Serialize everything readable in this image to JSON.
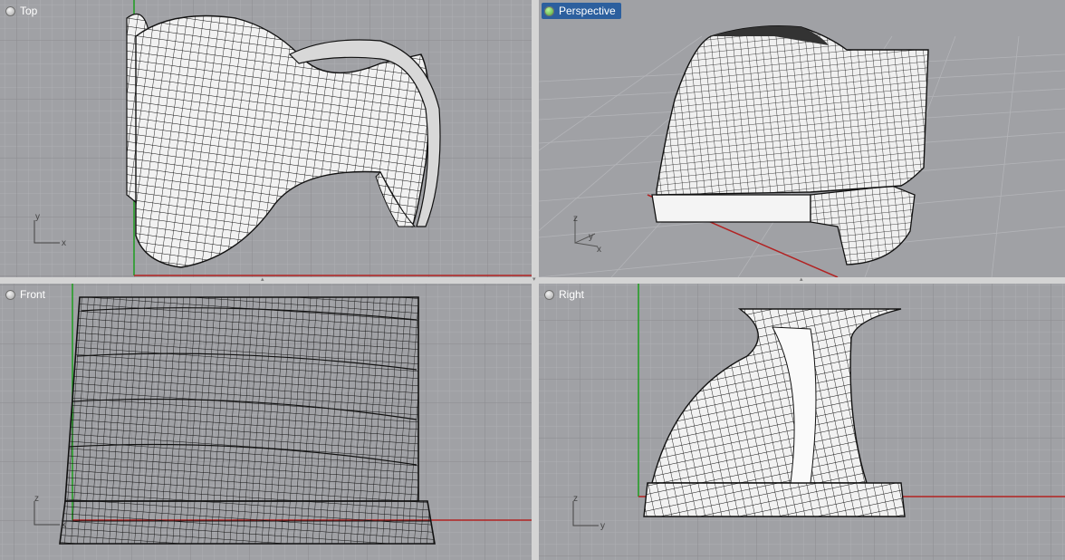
{
  "viewports": {
    "top": {
      "label": "Top",
      "active": false,
      "axes": [
        "y",
        "x"
      ]
    },
    "perspective": {
      "label": "Perspective",
      "active": true,
      "axes": [
        "z",
        "y",
        "x"
      ]
    },
    "front": {
      "label": "Front",
      "active": false,
      "axes": [
        "z",
        "x"
      ]
    },
    "right": {
      "label": "Right",
      "active": false,
      "axes": [
        "z",
        "y"
      ]
    }
  },
  "colors": {
    "viewport_bg": "#a0a1a5",
    "grid_minor": "#b2b3b7",
    "grid_major": "#8b8c90",
    "x_axis": "#b22222",
    "y_axis": "#1e9e1e",
    "active_label": "#2c5f9e",
    "mesh_fill": "#f2f2f2",
    "mesh_line": "#111111"
  },
  "icons": {
    "viewport_menu": "viewport-menu-dot-icon",
    "splitter": "splitter-handle-icon"
  }
}
